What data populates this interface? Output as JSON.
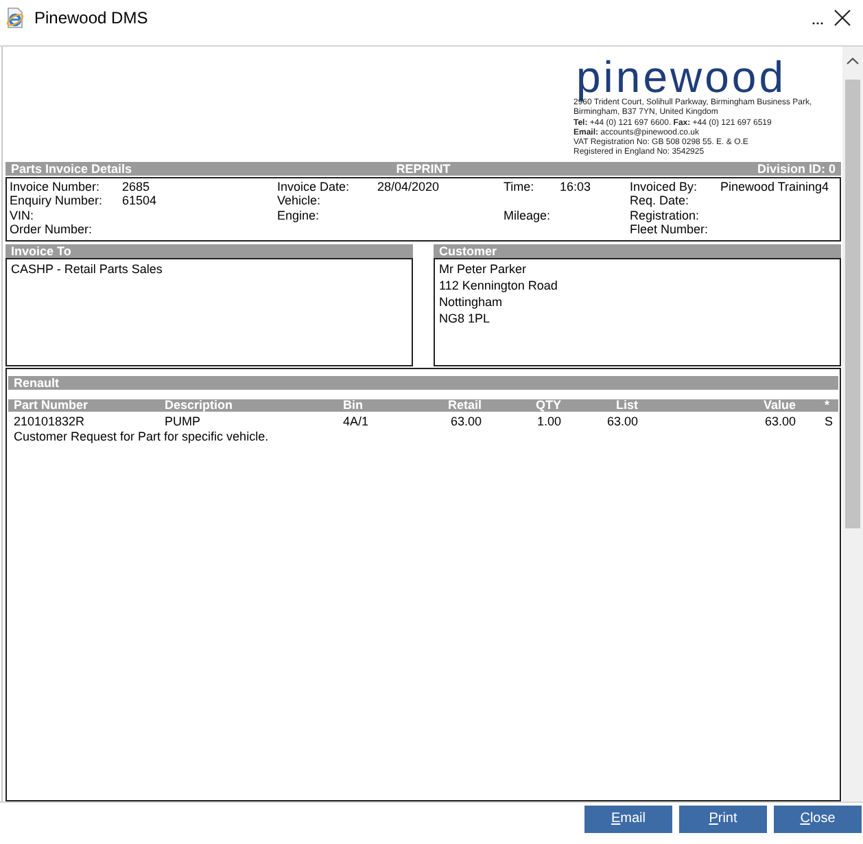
{
  "window": {
    "title": "Pinewood DMS"
  },
  "company": {
    "logo": "pinewood",
    "info_lines": [
      "2960 Trident Court, Solihull Parkway, Birmingham Business Park,",
      "Birmingham, B37 7YN, United Kingdom",
      "**Tel:** +44 (0) 121 697 6600. **Fax:** +44 (0) 121 697 6519",
      "**Email:** accounts@pinewood.co.uk",
      "VAT Registration No: GB 508 0298 55. E. & O.E",
      "Registered in England No: 3542925"
    ]
  },
  "invoice_details": {
    "title": "Parts Invoice Details",
    "status": "REPRINT",
    "division": "Division ID: 0",
    "rows": [
      [
        {
          "label": "Invoice Number:",
          "value": "2685"
        },
        {
          "label": "Invoice Date:",
          "value": "28/04/2020"
        },
        {
          "label": "Time:",
          "value": "16:03"
        },
        {
          "label": "Invoiced By:",
          "value": "Pinewood Training4"
        }
      ],
      [
        {
          "label": "Enquiry Number:",
          "value": "61504"
        },
        {
          "label": "Vehicle:"
        },
        null,
        {
          "label": "Req. Date:"
        }
      ],
      [
        {
          "label": "VIN:"
        },
        {
          "label": "Engine:"
        },
        {
          "label": "Mileage:"
        },
        {
          "label": "Registration:"
        }
      ],
      [
        {
          "label": "Order Number:"
        },
        null,
        null,
        {
          "label": "Fleet Number:"
        }
      ]
    ]
  },
  "invoice_to": {
    "title": "Invoice To",
    "lines": [
      "CASHP - Retail Parts Sales"
    ]
  },
  "customer": {
    "title": "Customer",
    "lines": [
      "Mr Peter Parker",
      "112 Kennington Road",
      "Nottingham",
      "NG8 1PL"
    ]
  },
  "parts": {
    "make": "Renault",
    "columns": [
      "Part Number",
      "Description",
      "Bin",
      "Retail",
      "QTY",
      "List",
      "Value",
      "*"
    ],
    "rows": [
      {
        "cells": [
          "210101832R",
          "PUMP",
          "4A/1",
          "63.00",
          "1.00",
          "63.00",
          "63.00",
          "S"
        ],
        "note": "Customer Request for Part for specific vehicle."
      }
    ]
  },
  "buttons": [
    "Email",
    "Print",
    "Close"
  ]
}
